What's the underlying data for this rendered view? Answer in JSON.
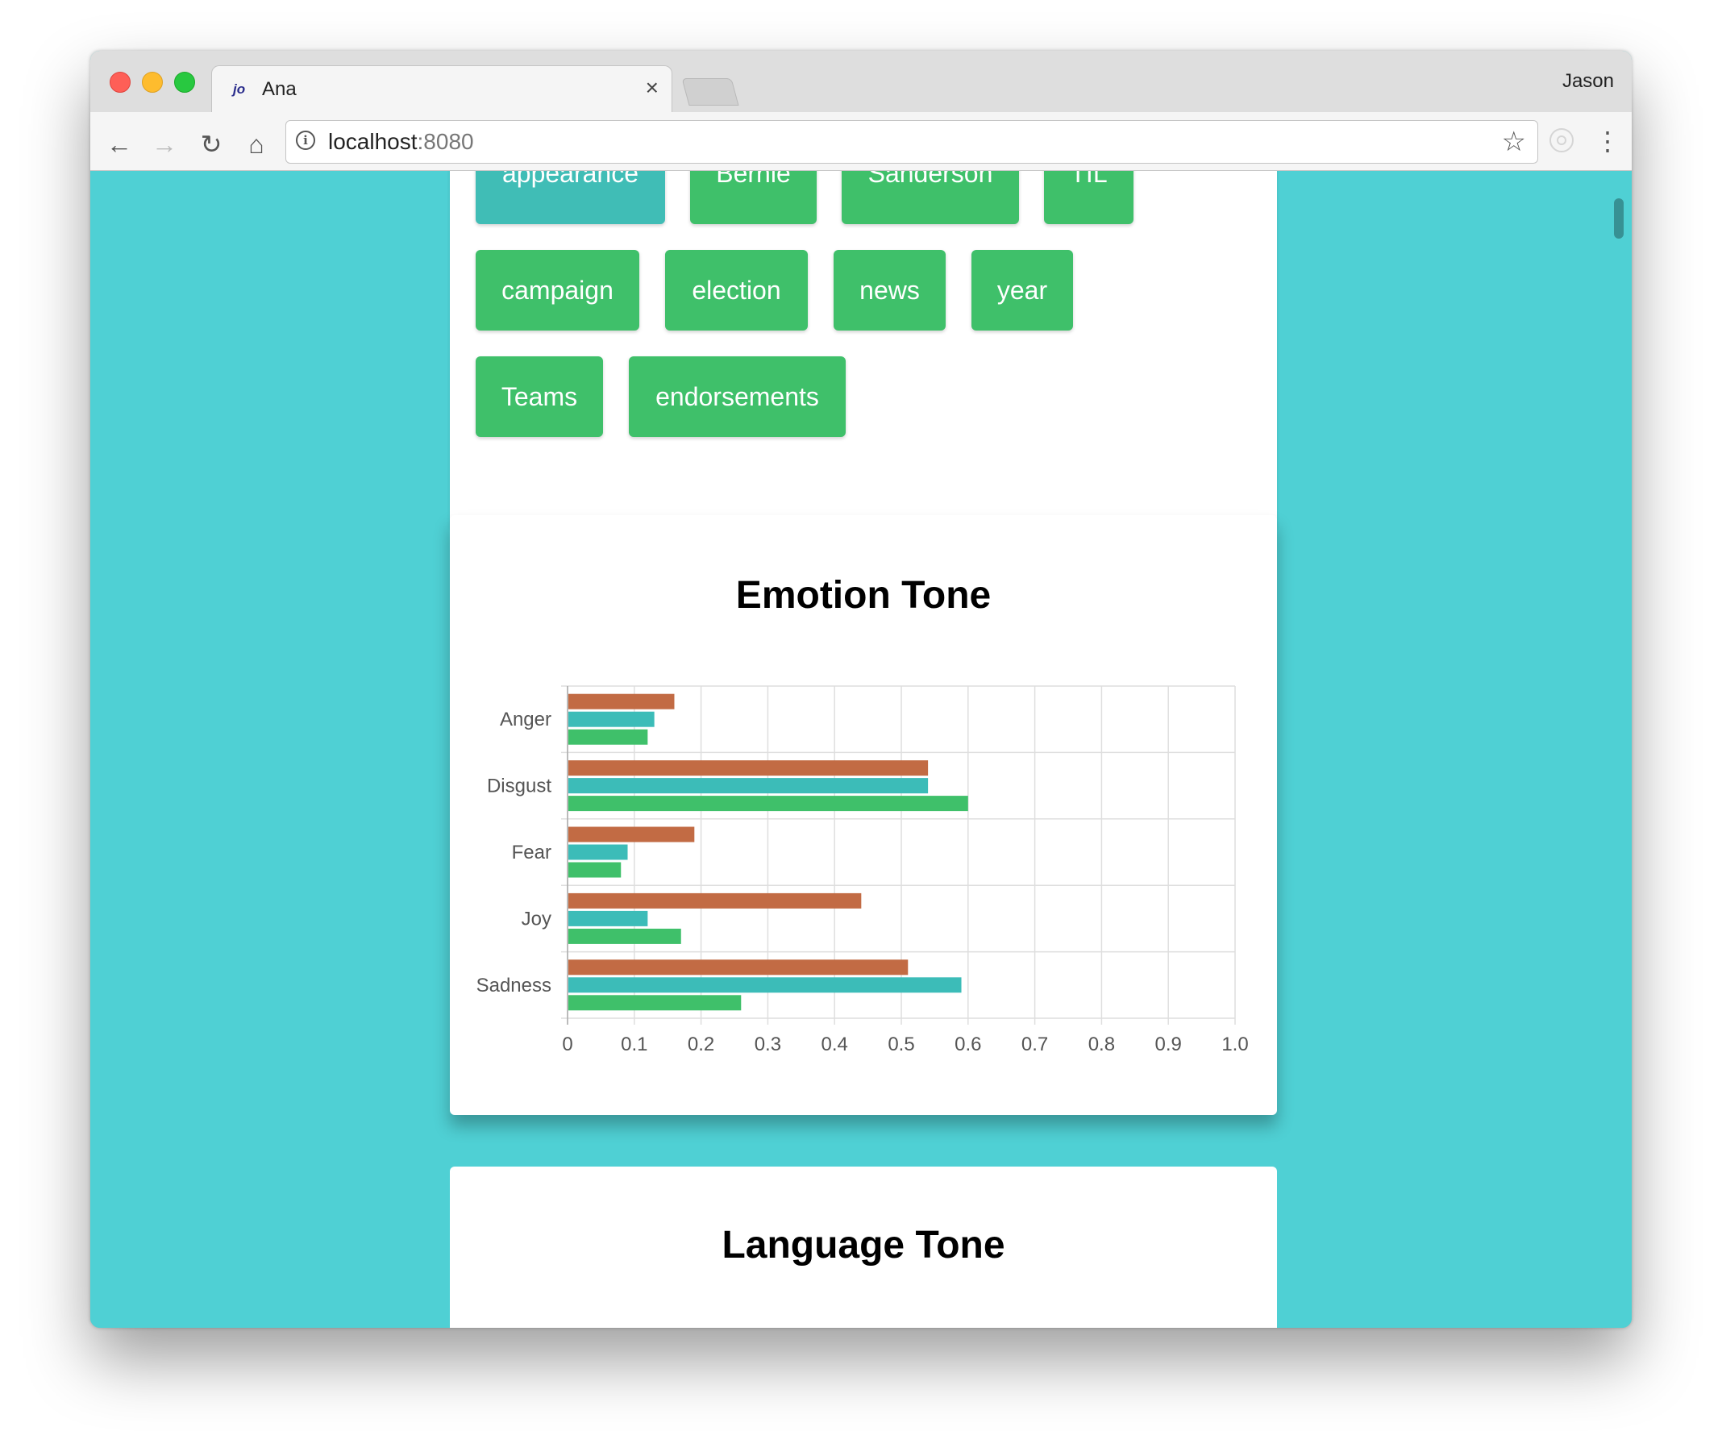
{
  "browser": {
    "tab_title": "Ana",
    "tab_favicon": "jo",
    "tab_close": "×",
    "profile_name": "Jason",
    "url_host": "localhost",
    "url_port": ":8080",
    "icons": {
      "back": "←",
      "forward": "→",
      "reload": "↻",
      "home": "⌂",
      "info": "i",
      "star": "☆",
      "menu": "⋮"
    }
  },
  "tags": {
    "items": [
      {
        "label": "appearance",
        "active": true
      },
      {
        "label": "Bernie",
        "active": false
      },
      {
        "label": "Sanderson",
        "active": false
      },
      {
        "label": "TIL",
        "active": false
      },
      {
        "label": "campaign",
        "active": false
      },
      {
        "label": "election",
        "active": false
      },
      {
        "label": "news",
        "active": false
      },
      {
        "label": "year",
        "active": false
      },
      {
        "label": "Teams",
        "active": false
      },
      {
        "label": "endorsements",
        "active": false
      }
    ],
    "colors": {
      "default": "#3fc06a",
      "active": "#40bdb6"
    }
  },
  "emotion_card": {
    "title": "Emotion Tone"
  },
  "language_card": {
    "title": "Language Tone"
  },
  "chart_data": {
    "type": "bar",
    "orientation": "horizontal",
    "title": "",
    "xlabel": "",
    "ylabel": "",
    "categories": [
      "Anger",
      "Disgust",
      "Fear",
      "Joy",
      "Sadness"
    ],
    "series": [
      {
        "color": "#c26b44",
        "values": [
          0.16,
          0.54,
          0.19,
          0.44,
          0.51
        ]
      },
      {
        "color": "#3cbcb8",
        "values": [
          0.13,
          0.54,
          0.09,
          0.12,
          0.59
        ]
      },
      {
        "color": "#3fc06a",
        "values": [
          0.12,
          0.6,
          0.08,
          0.17,
          0.26
        ]
      }
    ],
    "xlim": [
      0,
      1.0
    ],
    "xticks": [
      "0",
      "0.1",
      "0.2",
      "0.3",
      "0.4",
      "0.5",
      "0.6",
      "0.7",
      "0.8",
      "0.9",
      "1.0"
    ],
    "grid": true,
    "legend": "none"
  }
}
